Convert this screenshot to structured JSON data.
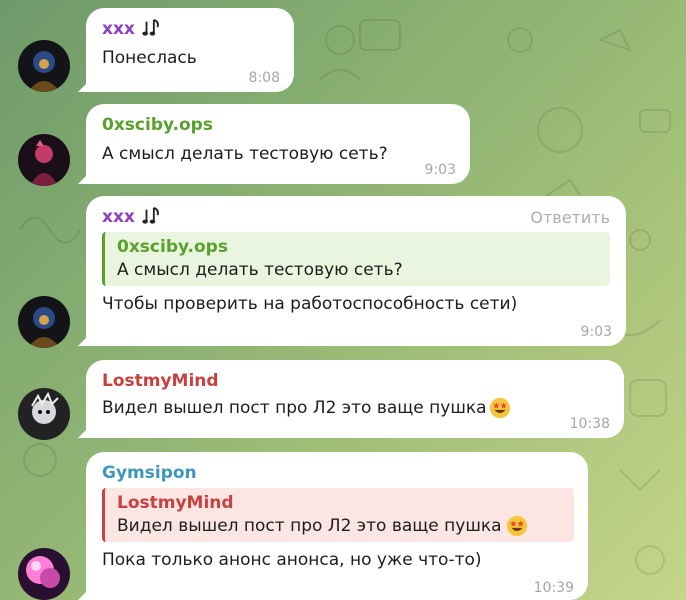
{
  "colors": {
    "name_purple": "#8e3fbf",
    "name_green": "#5aa02c",
    "name_red": "#c9413e",
    "name_teal": "#3c97ba",
    "quote_green_bg": "#eaf5e0",
    "quote_red_bg": "#fbe6e4",
    "time_gray": "#a3a9a0"
  },
  "messages": [
    {
      "sender": "xxx",
      "sender_icon": "music-notes-icon",
      "text": "Понеслась",
      "time": "8:08"
    },
    {
      "sender": "0xsciby.ops",
      "text": "А смысл делать тестовую сеть?",
      "time": "9:03"
    },
    {
      "sender": "xxx",
      "sender_icon": "music-notes-icon",
      "action": "Ответить",
      "quote": {
        "sender": "0xsciby.ops",
        "text": "А смысл делать тестовую сеть?"
      },
      "text": "Чтобы проверить на работоспособность сети)",
      "time": "9:03"
    },
    {
      "sender": "LostmyMind",
      "text": "Видел вышел пост про Л2 это ваще пушка",
      "emoji": "star-struck-emoji-icon",
      "time": "10:38"
    },
    {
      "sender": "Gymsipon",
      "quote": {
        "sender": "LostmyMind",
        "text": "Видел вышел пост про Л2 это ваще пушка",
        "emoji": "star-struck-emoji-icon"
      },
      "text": "Пока только анонс анонса, но уже что-то)",
      "time": "10:39"
    }
  ]
}
